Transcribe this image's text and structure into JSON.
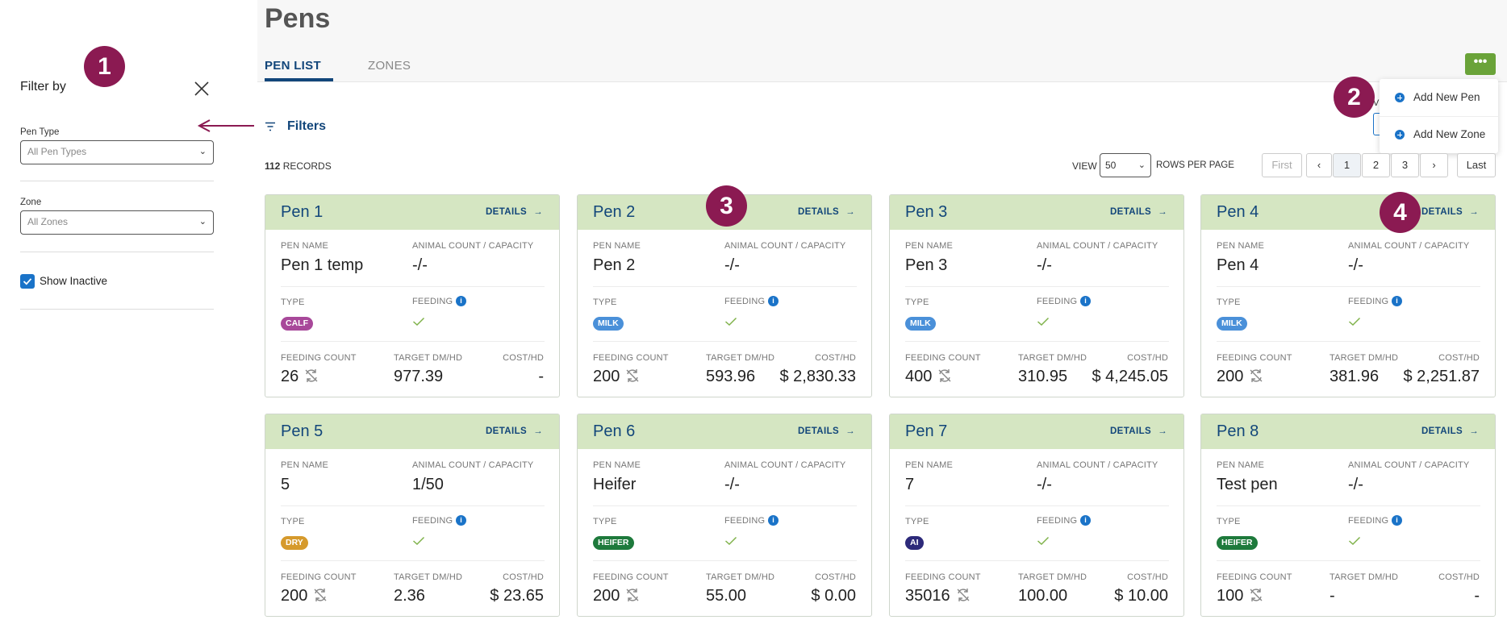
{
  "sidebar": {
    "title": "Filter by",
    "pen_type_label": "Pen Type",
    "pen_type_value": "All Pen Types",
    "zone_label": "Zone",
    "zone_value": "All Zones",
    "show_inactive_label": "Show Inactive",
    "show_inactive": true
  },
  "header": {
    "title": "Pens",
    "tabs": [
      {
        "label": "PEN LIST",
        "active": true
      },
      {
        "label": "ZONES",
        "active": false
      }
    ],
    "more_label": "•••"
  },
  "menu": {
    "items": [
      {
        "label": "Add New Pen"
      },
      {
        "label": "Add New Zone"
      }
    ],
    "partial_v": "V"
  },
  "toolbar": {
    "filters_label": "Filters",
    "records_count": "112",
    "records_label": "RECORDS",
    "view_label": "VIEW",
    "view_value": "50",
    "rows_per_page_label": "ROWS PER PAGE",
    "pagination": {
      "first": "First",
      "prev": "‹",
      "pages": [
        "1",
        "2",
        "3"
      ],
      "current": "1",
      "next": "›",
      "last": "Last"
    }
  },
  "card_labels": {
    "details": "DETAILS",
    "pen_name": "PEN NAME",
    "animal_count": "ANIMAL COUNT / CAPACITY",
    "type": "TYPE",
    "feeding": "FEEDING",
    "feeding_count": "FEEDING COUNT",
    "target_dm": "TARGET DM/HD",
    "cost": "COST/HD"
  },
  "colors": {
    "CALF": "#a8489a",
    "MILK": "#4a90d9",
    "DRY": "#d69a2c",
    "HEIFER": "#1e7a3c",
    "AI": "#2d2a7a",
    "marker": "#8b1a52",
    "accent": "#12467a"
  },
  "pens": [
    {
      "title": "Pen 1",
      "name": "Pen 1 temp",
      "animal_count": "-/-",
      "type": "CALF",
      "feeding_count": "26",
      "target_dm": "977.39",
      "cost": "-"
    },
    {
      "title": "Pen 2",
      "name": "Pen 2",
      "animal_count": "-/-",
      "type": "MILK",
      "feeding_count": "200",
      "target_dm": "593.96",
      "cost": "$ 2,830.33"
    },
    {
      "title": "Pen 3",
      "name": "Pen 3",
      "animal_count": "-/-",
      "type": "MILK",
      "feeding_count": "400",
      "target_dm": "310.95",
      "cost": "$ 4,245.05"
    },
    {
      "title": "Pen 4",
      "name": "Pen 4",
      "animal_count": "-/-",
      "type": "MILK",
      "feeding_count": "200",
      "target_dm": "381.96",
      "cost": "$ 2,251.87"
    },
    {
      "title": "Pen 5",
      "name": "5",
      "animal_count": "1/50",
      "type": "DRY",
      "feeding_count": "200",
      "target_dm": "2.36",
      "cost": "$ 23.65"
    },
    {
      "title": "Pen 6",
      "name": "Heifer",
      "animal_count": "-/-",
      "type": "HEIFER",
      "feeding_count": "200",
      "target_dm": "55.00",
      "cost": "$ 0.00"
    },
    {
      "title": "Pen 7",
      "name": "7",
      "animal_count": "-/-",
      "type": "AI",
      "feeding_count": "35016",
      "target_dm": "100.00",
      "cost": "$ 10.00"
    },
    {
      "title": "Pen 8",
      "name": "Test pen",
      "animal_count": "-/-",
      "type": "HEIFER",
      "feeding_count": "100",
      "target_dm": "-",
      "cost": "-"
    }
  ],
  "markers": [
    "1",
    "2",
    "3",
    "4"
  ]
}
